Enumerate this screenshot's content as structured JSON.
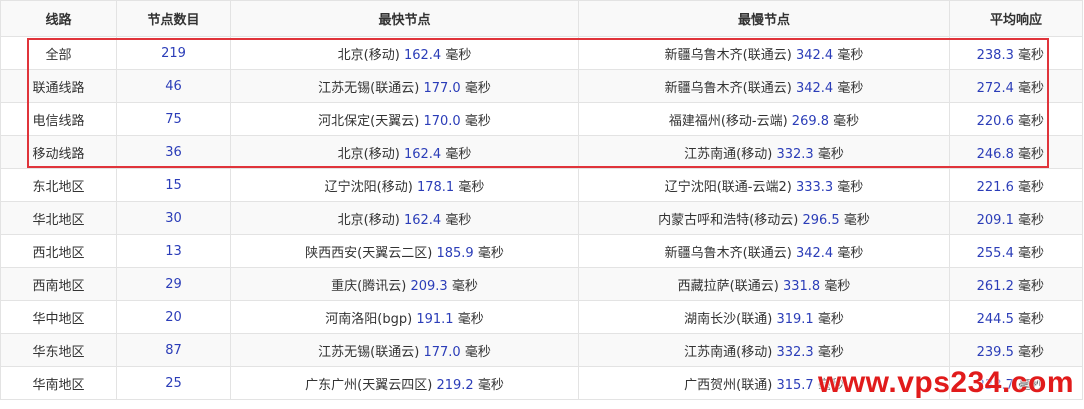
{
  "table": {
    "headers": [
      "线路",
      "节点数目",
      "最快节点",
      "最慢节点",
      "平均响应"
    ],
    "unit": "毫秒",
    "rows": [
      {
        "route": "全部",
        "count": "219",
        "fast_name": "北京(移动)",
        "fast_val": "162.4",
        "slow_name": "新疆乌鲁木齐(联通云)",
        "slow_val": "342.4",
        "avg": "238.3"
      },
      {
        "route": "联通线路",
        "count": "46",
        "fast_name": "江苏无锡(联通云)",
        "fast_val": "177.0",
        "slow_name": "新疆乌鲁木齐(联通云)",
        "slow_val": "342.4",
        "avg": "272.4"
      },
      {
        "route": "电信线路",
        "count": "75",
        "fast_name": "河北保定(天翼云)",
        "fast_val": "170.0",
        "slow_name": "福建福州(移动-云端)",
        "slow_val": "269.8",
        "avg": "220.6"
      },
      {
        "route": "移动线路",
        "count": "36",
        "fast_name": "北京(移动)",
        "fast_val": "162.4",
        "slow_name": "江苏南通(移动)",
        "slow_val": "332.3",
        "avg": "246.8"
      },
      {
        "route": "东北地区",
        "count": "15",
        "fast_name": "辽宁沈阳(移动)",
        "fast_val": "178.1",
        "slow_name": "辽宁沈阳(联通-云端2)",
        "slow_val": "333.3",
        "avg": "221.6"
      },
      {
        "route": "华北地区",
        "count": "30",
        "fast_name": "北京(移动)",
        "fast_val": "162.4",
        "slow_name": "内蒙古呼和浩特(移动云)",
        "slow_val": "296.5",
        "avg": "209.1"
      },
      {
        "route": "西北地区",
        "count": "13",
        "fast_name": "陕西西安(天翼云二区)",
        "fast_val": "185.9",
        "slow_name": "新疆乌鲁木齐(联通云)",
        "slow_val": "342.4",
        "avg": "255.4"
      },
      {
        "route": "西南地区",
        "count": "29",
        "fast_name": "重庆(腾讯云)",
        "fast_val": "209.3",
        "slow_name": "西藏拉萨(联通云)",
        "slow_val": "331.8",
        "avg": "261.2"
      },
      {
        "route": "华中地区",
        "count": "20",
        "fast_name": "河南洛阳(bgp)",
        "fast_val": "191.1",
        "slow_name": "湖南长沙(联通)",
        "slow_val": "319.1",
        "avg": "244.5"
      },
      {
        "route": "华东地区",
        "count": "87",
        "fast_name": "江苏无锡(联通云)",
        "fast_val": "177.0",
        "slow_name": "江苏南通(移动)",
        "slow_val": "332.3",
        "avg": "239.5"
      },
      {
        "route": "华南地区",
        "count": "25",
        "fast_name": "广东广州(天翼云四区)",
        "fast_val": "219.2",
        "slow_name": "广西贺州(联通)",
        "slow_val": "315.7",
        "avg": "238.7"
      }
    ]
  },
  "watermark": "www.vps234.com",
  "colors": {
    "number": "#2b3db8",
    "highlight": "#e0343b",
    "watermark": "#e11b1b",
    "border": "#e3e3e3"
  }
}
